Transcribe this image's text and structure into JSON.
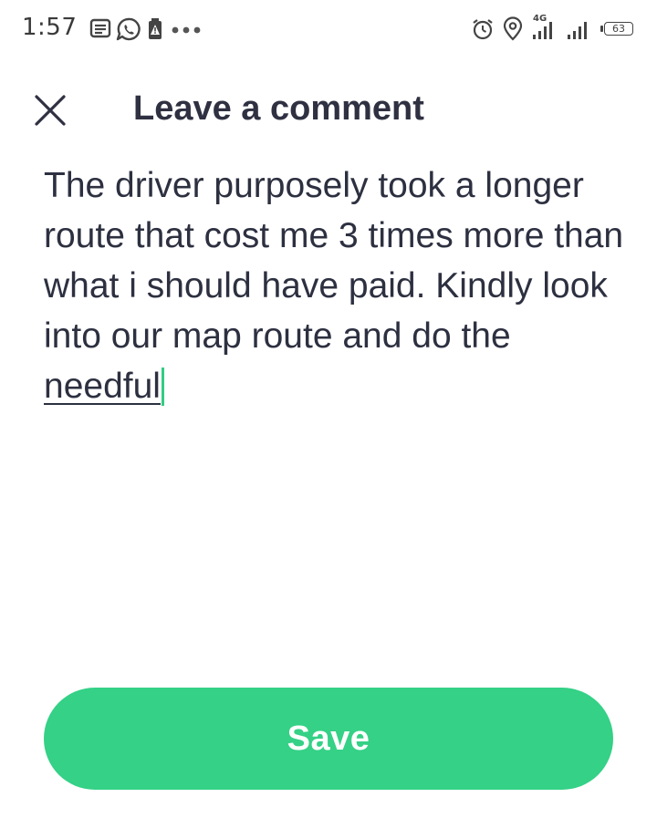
{
  "status_bar": {
    "time": "1:57",
    "left_icons": [
      "message-icon",
      "whatsapp-icon",
      "battery-alert-icon",
      "more-dots-icon"
    ],
    "right_icons": [
      "alarm-icon",
      "location-icon",
      "signal-4g-icon",
      "signal-icon",
      "battery-icon"
    ],
    "network_type": "4G",
    "battery_level": "63"
  },
  "header": {
    "close_icon": "close-icon",
    "title": "Leave a comment"
  },
  "comment": {
    "text_before_current_word": "The driver purposely took a longer route that cost me 3 times more than what i should have paid. Kindly look into our map route and do the ",
    "current_word": "needful",
    "caret_color": "#32cc84"
  },
  "actions": {
    "save_label": "Save"
  },
  "colors": {
    "accent": "#34d186",
    "text_primary": "#2d3040",
    "background": "#ffffff"
  }
}
